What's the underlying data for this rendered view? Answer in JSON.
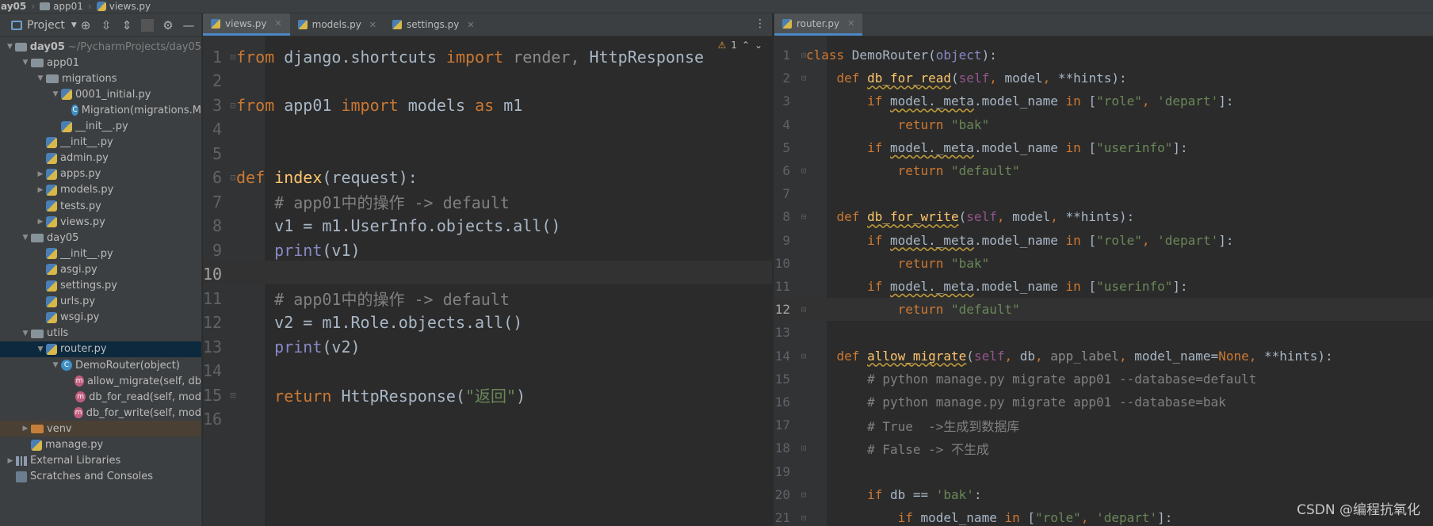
{
  "breadcrumb": [
    "ay05",
    "app01",
    "views.py"
  ],
  "project_panel": {
    "title": "Project",
    "tree": [
      {
        "arrow": "v",
        "icon": "folder",
        "label": "day05",
        "hint": "~/PycharmProjects/day05",
        "bold": true
      },
      {
        "arrow": "v",
        "icon": "folder",
        "label": "app01"
      },
      {
        "arrow": "v",
        "icon": "folder",
        "label": "migrations"
      },
      {
        "arrow": "v",
        "icon": "py",
        "label": "0001_initial.py"
      },
      {
        "arrow": "",
        "icon": "class",
        "label": "Migration(migrations.M"
      },
      {
        "arrow": "",
        "icon": "py",
        "label": "__init__.py"
      },
      {
        "arrow": "",
        "icon": "py",
        "label": "__init__.py"
      },
      {
        "arrow": "",
        "icon": "py",
        "label": "admin.py"
      },
      {
        "arrow": ">",
        "icon": "py",
        "label": "apps.py"
      },
      {
        "arrow": ">",
        "icon": "py",
        "label": "models.py"
      },
      {
        "arrow": "",
        "icon": "py",
        "label": "tests.py"
      },
      {
        "arrow": ">",
        "icon": "py",
        "label": "views.py"
      },
      {
        "arrow": "v",
        "icon": "folder",
        "label": "day05"
      },
      {
        "arrow": "",
        "icon": "py",
        "label": "__init__.py"
      },
      {
        "arrow": "",
        "icon": "py",
        "label": "asgi.py"
      },
      {
        "arrow": "",
        "icon": "py",
        "label": "settings.py"
      },
      {
        "arrow": "",
        "icon": "py",
        "label": "urls.py"
      },
      {
        "arrow": "",
        "icon": "py",
        "label": "wsgi.py"
      },
      {
        "arrow": "v",
        "icon": "folder",
        "label": "utils"
      },
      {
        "arrow": "v",
        "icon": "py",
        "label": "router.py",
        "selected": true
      },
      {
        "arrow": "v",
        "icon": "class",
        "label": "DemoRouter(object)"
      },
      {
        "arrow": "",
        "icon": "method",
        "label": "allow_migrate(self, db"
      },
      {
        "arrow": "",
        "icon": "method",
        "label": "db_for_read(self, mod"
      },
      {
        "arrow": "",
        "icon": "method",
        "label": "db_for_write(self, mod"
      },
      {
        "arrow": ">",
        "icon": "folder-orange",
        "label": "venv",
        "venv": true
      },
      {
        "arrow": "",
        "icon": "py",
        "label": "manage.py"
      },
      {
        "arrow": ">",
        "icon": "libs",
        "label": "External Libraries"
      },
      {
        "arrow": "",
        "icon": "scratch",
        "label": "Scratches and Consoles"
      }
    ]
  },
  "left_editor": {
    "tabs": [
      {
        "label": "views.py",
        "active": true
      },
      {
        "label": "models.py"
      },
      {
        "label": "settings.py"
      }
    ],
    "warning": "1",
    "current_line": 10,
    "lines": [
      {
        "n": "1",
        "fold": "⊟",
        "tokens": [
          [
            "kw",
            "from "
          ],
          [
            "txt",
            "django.shortcuts "
          ],
          [
            "kw",
            "import "
          ],
          [
            "gray",
            "render, "
          ],
          [
            "txt",
            "HttpResponse"
          ]
        ]
      },
      {
        "n": "2",
        "tokens": []
      },
      {
        "n": "3",
        "fold": "⊟",
        "tokens": [
          [
            "kw",
            "from "
          ],
          [
            "txt",
            "app01 "
          ],
          [
            "kw",
            "import "
          ],
          [
            "txt",
            "models "
          ],
          [
            "kw",
            "as "
          ],
          [
            "txt",
            "m1"
          ]
        ]
      },
      {
        "n": "4",
        "tokens": []
      },
      {
        "n": "5",
        "tokens": []
      },
      {
        "n": "6",
        "fold": "⊟",
        "tokens": [
          [
            "kw",
            "def "
          ],
          [
            "fn",
            "index"
          ],
          [
            "txt",
            "(request):"
          ]
        ]
      },
      {
        "n": "7",
        "tokens": [
          [
            "txt",
            "    "
          ],
          [
            "cm",
            "# app01中的操作 -> default"
          ]
        ]
      },
      {
        "n": "8",
        "tokens": [
          [
            "txt",
            "    v1 = m1.UserInfo.objects.all()"
          ]
        ]
      },
      {
        "n": "9",
        "tokens": [
          [
            "txt",
            "    "
          ],
          [
            "bi",
            "print"
          ],
          [
            "txt",
            "(v1)"
          ]
        ]
      },
      {
        "n": "10",
        "tokens": []
      },
      {
        "n": "11",
        "tokens": [
          [
            "txt",
            "    "
          ],
          [
            "cm",
            "# app01中的操作 -> default"
          ]
        ]
      },
      {
        "n": "12",
        "tokens": [
          [
            "txt",
            "    v2 = m1.Role.objects.all()"
          ]
        ]
      },
      {
        "n": "13",
        "tokens": [
          [
            "txt",
            "    "
          ],
          [
            "bi",
            "print"
          ],
          [
            "txt",
            "(v2)"
          ]
        ]
      },
      {
        "n": "14",
        "tokens": []
      },
      {
        "n": "15",
        "fold": "⊡",
        "tokens": [
          [
            "txt",
            "    "
          ],
          [
            "kw",
            "return "
          ],
          [
            "txt",
            "HttpResponse("
          ],
          [
            "str",
            "\"返回\""
          ],
          [
            "txt",
            ")"
          ]
        ]
      },
      {
        "n": "16",
        "tokens": []
      }
    ]
  },
  "right_editor": {
    "tabs": [
      {
        "label": "router.py",
        "active": true
      }
    ],
    "current_line": 12,
    "lines": [
      {
        "n": "1",
        "fold": "⊟",
        "tokens": [
          [
            "kw",
            "class "
          ],
          [
            "txt",
            "DemoRouter("
          ],
          [
            "bi",
            "object"
          ],
          [
            "txt",
            "):"
          ]
        ]
      },
      {
        "n": "2",
        "fold": "⊟",
        "tokens": [
          [
            "txt",
            "    "
          ],
          [
            "kw",
            "def "
          ],
          [
            "fn ul",
            "db_for_read"
          ],
          [
            "txt",
            "("
          ],
          [
            "self",
            "self"
          ],
          [
            "kw",
            ", "
          ],
          [
            "txt",
            "model"
          ],
          [
            "kw",
            ", "
          ],
          [
            "txt",
            "**hints):"
          ]
        ]
      },
      {
        "n": "3",
        "tokens": [
          [
            "txt",
            "        "
          ],
          [
            "kw",
            "if "
          ],
          [
            "txt ul",
            "model._meta"
          ],
          [
            "txt",
            ".model_name "
          ],
          [
            "kw",
            "in "
          ],
          [
            "txt",
            "["
          ],
          [
            "str",
            "\"role\""
          ],
          [
            "kw",
            ", "
          ],
          [
            "str",
            "'depart'"
          ],
          [
            "txt",
            "]:"
          ]
        ]
      },
      {
        "n": "4",
        "tokens": [
          [
            "txt",
            "            "
          ],
          [
            "kw",
            "return "
          ],
          [
            "str",
            "\"bak\""
          ]
        ]
      },
      {
        "n": "5",
        "tokens": [
          [
            "txt",
            "        "
          ],
          [
            "kw",
            "if "
          ],
          [
            "txt ul",
            "model._meta"
          ],
          [
            "txt",
            ".model_name "
          ],
          [
            "kw",
            "in "
          ],
          [
            "txt",
            "["
          ],
          [
            "str",
            "\"userinfo\""
          ],
          [
            "txt",
            "]:"
          ]
        ]
      },
      {
        "n": "6",
        "fold": "⊡",
        "tokens": [
          [
            "txt",
            "            "
          ],
          [
            "kw",
            "return "
          ],
          [
            "str",
            "\"default\""
          ]
        ]
      },
      {
        "n": "7",
        "tokens": []
      },
      {
        "n": "8",
        "fold": "⊟",
        "tokens": [
          [
            "txt",
            "    "
          ],
          [
            "kw",
            "def "
          ],
          [
            "fn ul",
            "db_for_write"
          ],
          [
            "txt",
            "("
          ],
          [
            "self",
            "self"
          ],
          [
            "kw",
            ", "
          ],
          [
            "txt",
            "model"
          ],
          [
            "kw",
            ", "
          ],
          [
            "txt",
            "**hints):"
          ]
        ]
      },
      {
        "n": "9",
        "tokens": [
          [
            "txt",
            "        "
          ],
          [
            "kw",
            "if "
          ],
          [
            "txt ul",
            "model._meta"
          ],
          [
            "txt",
            ".model_name "
          ],
          [
            "kw",
            "in "
          ],
          [
            "txt",
            "["
          ],
          [
            "str",
            "\"role\""
          ],
          [
            "kw",
            ", "
          ],
          [
            "str",
            "'depart'"
          ],
          [
            "txt",
            "]:"
          ]
        ]
      },
      {
        "n": "10",
        "tokens": [
          [
            "txt",
            "            "
          ],
          [
            "kw",
            "return "
          ],
          [
            "str",
            "\"bak\""
          ]
        ]
      },
      {
        "n": "11",
        "tokens": [
          [
            "txt",
            "        "
          ],
          [
            "kw",
            "if "
          ],
          [
            "txt ul",
            "model._meta"
          ],
          [
            "txt",
            ".model_name "
          ],
          [
            "kw",
            "in "
          ],
          [
            "txt",
            "["
          ],
          [
            "str",
            "\"userinfo\""
          ],
          [
            "txt",
            "]:"
          ]
        ]
      },
      {
        "n": "12",
        "fold": "⊡",
        "tokens": [
          [
            "txt",
            "            "
          ],
          [
            "kw",
            "return "
          ],
          [
            "str",
            "\"default\""
          ]
        ]
      },
      {
        "n": "13",
        "tokens": []
      },
      {
        "n": "14",
        "fold": "⊟",
        "tokens": [
          [
            "txt",
            "    "
          ],
          [
            "kw",
            "def "
          ],
          [
            "fn ul",
            "allow_migrate"
          ],
          [
            "txt",
            "("
          ],
          [
            "self",
            "self"
          ],
          [
            "kw",
            ", "
          ],
          [
            "txt",
            "db"
          ],
          [
            "kw",
            ", "
          ],
          [
            "gray",
            "app_label"
          ],
          [
            "kw",
            ", "
          ],
          [
            "txt",
            "model_name="
          ],
          [
            "kw",
            "None"
          ],
          [
            "kw",
            ", "
          ],
          [
            "txt",
            "**hints):"
          ]
        ]
      },
      {
        "n": "15",
        "tokens": [
          [
            "txt",
            "        "
          ],
          [
            "cm",
            "# python manage.py migrate app01 --database=default"
          ]
        ]
      },
      {
        "n": "16",
        "tokens": [
          [
            "txt",
            "        "
          ],
          [
            "cm",
            "# python manage.py migrate app01 --database=bak"
          ]
        ]
      },
      {
        "n": "17",
        "tokens": [
          [
            "txt",
            "        "
          ],
          [
            "cm",
            "# True  ->生成到数据库"
          ]
        ]
      },
      {
        "n": "18",
        "fold": "⊡",
        "tokens": [
          [
            "txt",
            "        "
          ],
          [
            "cm",
            "# False -> 不生成"
          ]
        ]
      },
      {
        "n": "19",
        "tokens": []
      },
      {
        "n": "20",
        "fold": "⊟",
        "tokens": [
          [
            "txt",
            "        "
          ],
          [
            "kw",
            "if "
          ],
          [
            "txt",
            "db == "
          ],
          [
            "str",
            "'bak'"
          ],
          [
            "txt",
            ":"
          ]
        ]
      },
      {
        "n": "21",
        "fold": "⊟",
        "tokens": [
          [
            "txt",
            "            "
          ],
          [
            "kw",
            "if "
          ],
          [
            "txt",
            "model_name "
          ],
          [
            "kw",
            "in "
          ],
          [
            "txt",
            "["
          ],
          [
            "str",
            "\"role\""
          ],
          [
            "kw",
            ", "
          ],
          [
            "str",
            "'depart'"
          ],
          [
            "txt",
            "]:"
          ]
        ]
      }
    ]
  },
  "watermark": "CSDN @编程抗氧化",
  "colors": {
    "keyword": "#cc7832",
    "function": "#ffc66d",
    "string": "#6a8759",
    "comment": "#808080",
    "builtin": "#8888c6",
    "self": "#94558d",
    "accent": "#4a88c7"
  }
}
